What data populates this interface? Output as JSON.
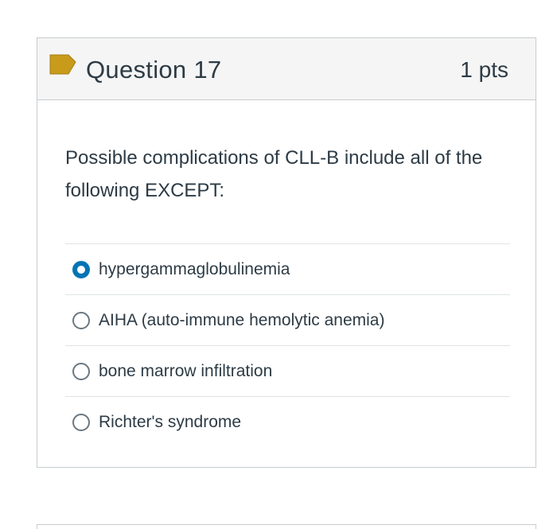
{
  "question": {
    "title": "Question 17",
    "points": "1 pts",
    "text": "Possible complications of CLL-B include all of the following EXCEPT:",
    "flag_color": "#c89b1a",
    "answers": [
      {
        "label": "hypergammaglobulinemia",
        "selected": true
      },
      {
        "label": "AIHA (auto-immune hemolytic anemia)",
        "selected": false
      },
      {
        "label": "bone marrow infiltration",
        "selected": false
      },
      {
        "label": "Richter's syndrome",
        "selected": false
      }
    ]
  },
  "colors": {
    "accent": "#0374b5",
    "text": "#2d3b45",
    "border": "#c7cdd1",
    "header_bg": "#f5f5f5"
  }
}
